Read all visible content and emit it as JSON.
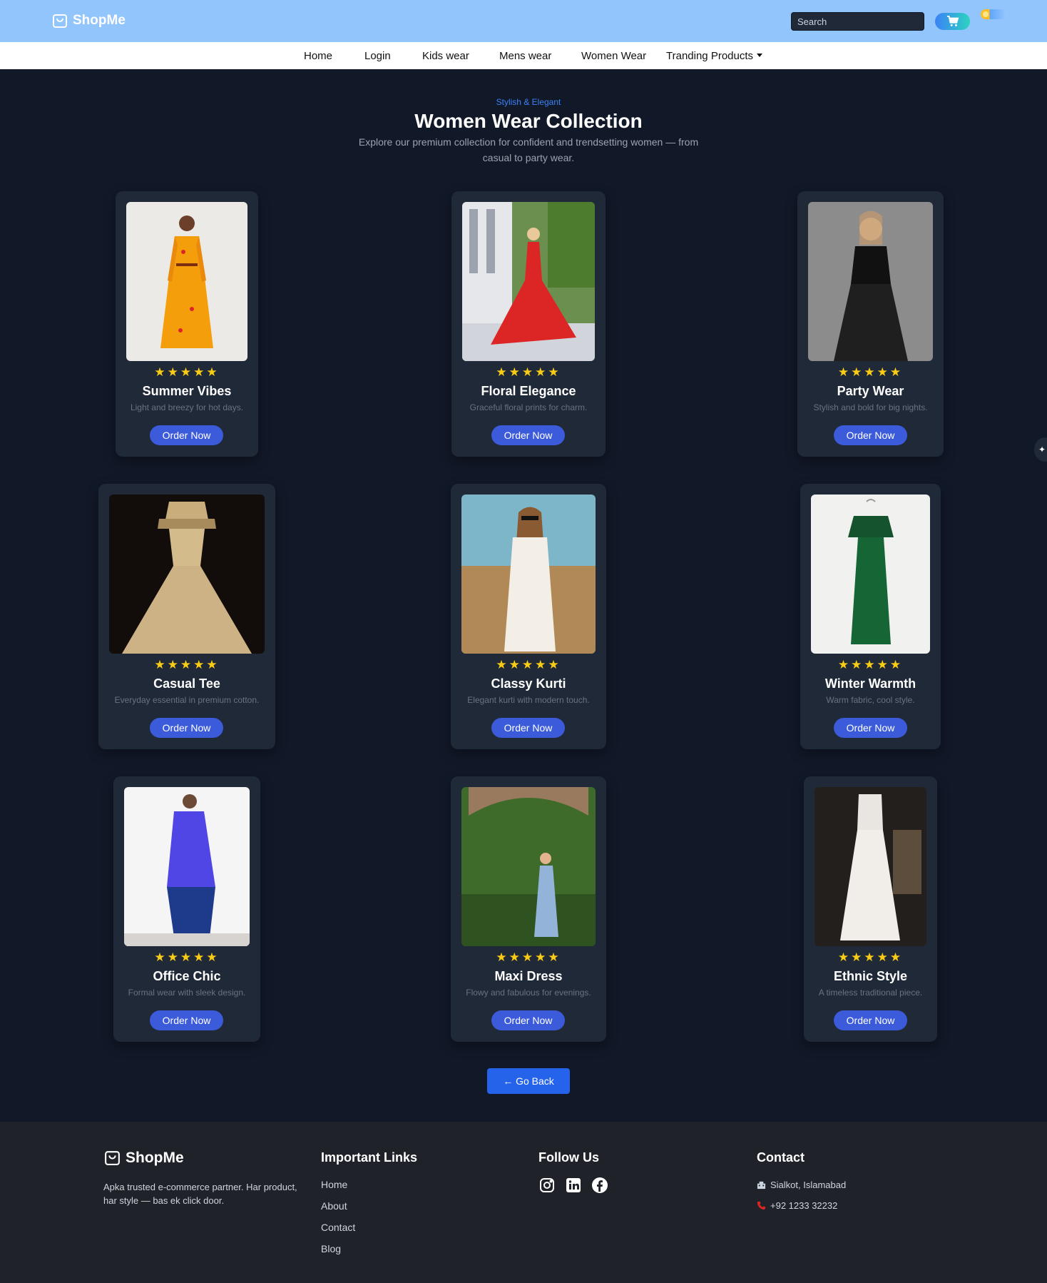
{
  "header": {
    "logo_text": "ShopMe",
    "search_placeholder": "Search",
    "cart_icon": "cart-icon",
    "theme_toggle": "theme-toggle"
  },
  "nav": {
    "items": [
      "Home",
      "Login",
      "Kids wear",
      "Mens wear",
      "Women Wear"
    ],
    "dropdown_label": "Tranding Products"
  },
  "hero": {
    "kicker": "Stylish & Elegant",
    "title": "Women Wear Collection",
    "subtitle": "Explore our premium collection for confident and trendsetting women — from casual to party wear."
  },
  "products": [
    {
      "title": "Summer Vibes",
      "desc": "Light and breezy for hot days.",
      "rating": 5,
      "button": "Order Now"
    },
    {
      "title": "Floral Elegance",
      "desc": "Graceful floral prints for charm.",
      "rating": 5,
      "button": "Order Now"
    },
    {
      "title": "Party Wear",
      "desc": "Stylish and bold for big nights.",
      "rating": 5,
      "button": "Order Now"
    },
    {
      "title": "Casual Tee",
      "desc": "Everyday essential in premium cotton.",
      "rating": 5,
      "button": "Order Now"
    },
    {
      "title": "Classy Kurti",
      "desc": "Elegant kurti with modern touch.",
      "rating": 5,
      "button": "Order Now"
    },
    {
      "title": "Winter Warmth",
      "desc": "Warm fabric, cool style.",
      "rating": 5,
      "button": "Order Now"
    },
    {
      "title": "Office Chic",
      "desc": "Formal wear with sleek design.",
      "rating": 5,
      "button": "Order Now"
    },
    {
      "title": "Maxi Dress",
      "desc": "Flowy and fabulous for evenings.",
      "rating": 5,
      "button": "Order Now"
    },
    {
      "title": "Ethnic Style",
      "desc": "A timeless traditional piece.",
      "rating": 5,
      "button": "Order Now"
    }
  ],
  "stars_text": "★★★★★",
  "go_back": "← Go Back",
  "footer": {
    "logo_text": "ShopMe",
    "about": "Apka trusted e-commerce partner. Har product, har style — bas ek click door.",
    "links_heading": "Important Links",
    "links": [
      "Home",
      "About",
      "Contact",
      "Blog"
    ],
    "follow_heading": "Follow Us",
    "socials": [
      "instagram-icon",
      "linkedin-icon",
      "facebook-icon"
    ],
    "contact_heading": "Contact",
    "address": "Sialkot, Islamabad",
    "phone": "+92 1233 32232"
  },
  "colors": {
    "header_bg": "#93c5fd",
    "page_bg": "#111827",
    "card_bg": "#1f2937",
    "accent": "#3b5bdb",
    "stars": "#facc15",
    "footer_bg": "#1f2329"
  }
}
